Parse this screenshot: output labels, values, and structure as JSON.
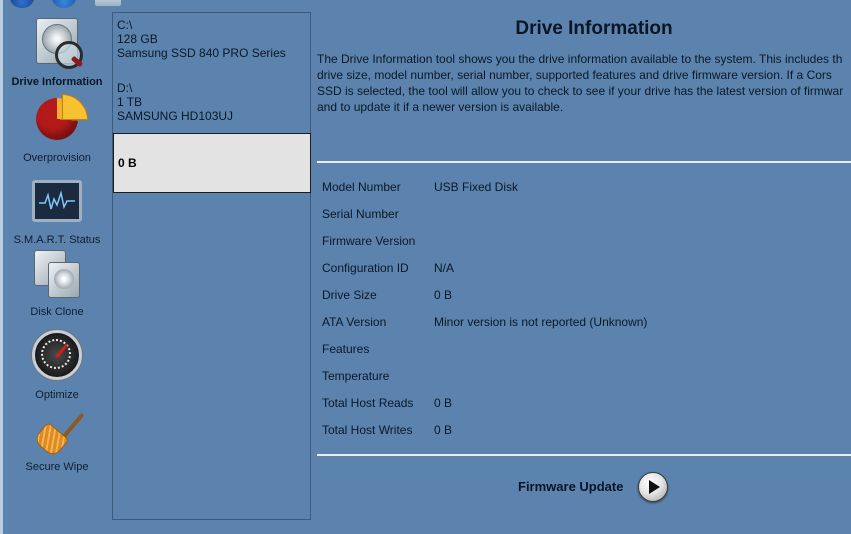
{
  "nav": {
    "items": [
      {
        "label": "Drive Information",
        "icon": "drive-info-icon",
        "active": true
      },
      {
        "label": "Overprovision",
        "icon": "pie-chart-icon"
      },
      {
        "label": "S.M.A.R.T. Status",
        "icon": "monitor-icon"
      },
      {
        "label": "Disk Clone",
        "icon": "disk-clone-icon"
      },
      {
        "label": "Optimize",
        "icon": "gauge-icon"
      },
      {
        "label": "Secure Wipe",
        "icon": "broom-icon"
      }
    ]
  },
  "drives": [
    {
      "path": "C:\\",
      "size": "128 GB",
      "model": "Samsung SSD 840 PRO Series"
    },
    {
      "path": "D:\\",
      "size": "1 TB",
      "model": "SAMSUNG HD103UJ"
    },
    {
      "size": "0 B",
      "selected": true
    }
  ],
  "main": {
    "title": "Drive Information",
    "description_lines": [
      "The Drive Information tool shows you the drive information available to the system. This includes th",
      "drive size, model number, serial number, supported features and drive firmware version.  If a Cors",
      "SSD is selected, the tool will allow you to check to see if your drive has the latest version of firmwar",
      "and to update it if a newer version is available."
    ],
    "info": [
      {
        "key": "Model Number",
        "value": "USB Fixed Disk"
      },
      {
        "key": "Serial Number",
        "value": ""
      },
      {
        "key": "Firmware Version",
        "value": ""
      },
      {
        "key": "Configuration ID",
        "value": "N/A"
      },
      {
        "key": "Drive Size",
        "value": "0 B"
      },
      {
        "key": "ATA Version",
        "value": "Minor version is not reported (Unknown)"
      },
      {
        "key": "Features",
        "value": ""
      },
      {
        "key": "Temperature",
        "value": ""
      },
      {
        "key": "Total Host Reads",
        "value": "0 B"
      },
      {
        "key": "Total Host Writes",
        "value": "0 B"
      }
    ],
    "firmware_update_label": "Firmware Update"
  },
  "colors": {
    "background": "#5c83ae",
    "selected_row": "#e3e3e3",
    "divider": "#e9eef4"
  }
}
